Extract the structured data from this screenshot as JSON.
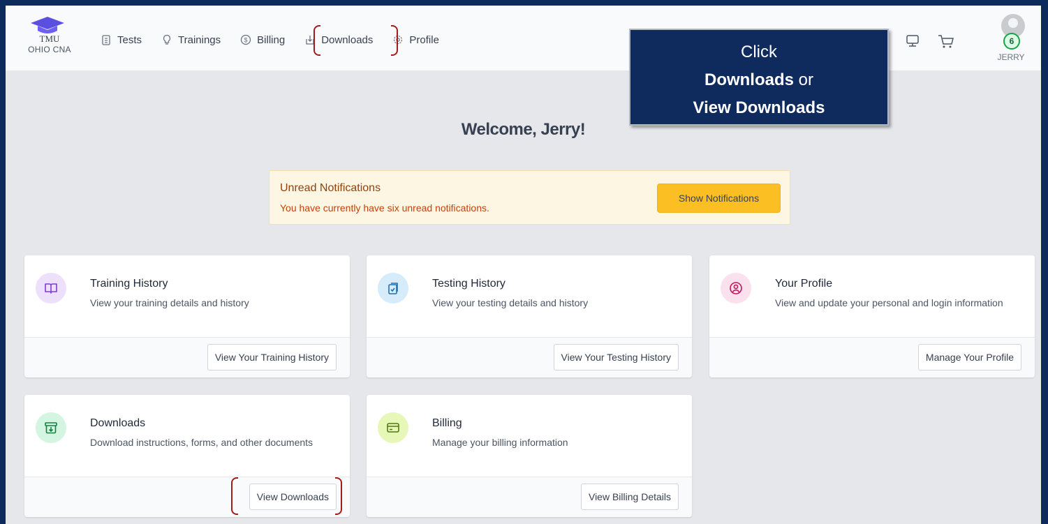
{
  "brand": {
    "name": "TMU",
    "subtitle": "OHIO CNA"
  },
  "nav": [
    {
      "label": "Tests",
      "icon": "clipboard-icon"
    },
    {
      "label": "Trainings",
      "icon": "lightbulb-icon"
    },
    {
      "label": "Billing",
      "icon": "dollar-circle-icon"
    },
    {
      "label": "Downloads",
      "icon": "download-icon"
    },
    {
      "label": "Profile",
      "icon": "gear-icon"
    }
  ],
  "user": {
    "name": "JERRY",
    "notification_count": "6"
  },
  "callout": {
    "line1": "Click",
    "line2_bold": "Downloads",
    "line2_rest": " or",
    "line3": "View Downloads"
  },
  "welcome": "Welcome, Jerry!",
  "notification": {
    "title": "Unread Notifications",
    "text": "You have currently have six unread notifications.",
    "button": "Show Notifications"
  },
  "cards": [
    {
      "title": "Training History",
      "desc": "View your training details and history",
      "button": "View Your Training History",
      "icon": "book-icon",
      "icon_bg": "#ede0fb",
      "icon_color": "#7e3bd6"
    },
    {
      "title": "Testing History",
      "desc": "View your testing details and history",
      "button": "View Your Testing History",
      "icon": "clipboard-check-icon",
      "icon_bg": "#d6ecfb",
      "icon_color": "#1d70b8"
    },
    {
      "title": "Your Profile",
      "desc": "View and update your personal and login information",
      "button": "Manage Your Profile",
      "icon": "user-circle-icon",
      "icon_bg": "#fbe0ee",
      "icon_color": "#be185d"
    },
    {
      "title": "Downloads",
      "desc": "Download instructions, forms, and other documents",
      "button": "View Downloads",
      "icon": "archive-download-icon",
      "icon_bg": "#d3f5e1",
      "icon_color": "#15803d"
    },
    {
      "title": "Billing",
      "desc": "Manage your billing information",
      "button": "View Billing Details",
      "icon": "credit-card-icon",
      "icon_bg": "#e6f7b8",
      "icon_color": "#4d7c0f"
    }
  ],
  "colors": {
    "frame": "#0c2a5b",
    "callout_bg": "#0f2a5c",
    "highlight": "#9b1c1c",
    "accent_button": "#fbbf24"
  }
}
